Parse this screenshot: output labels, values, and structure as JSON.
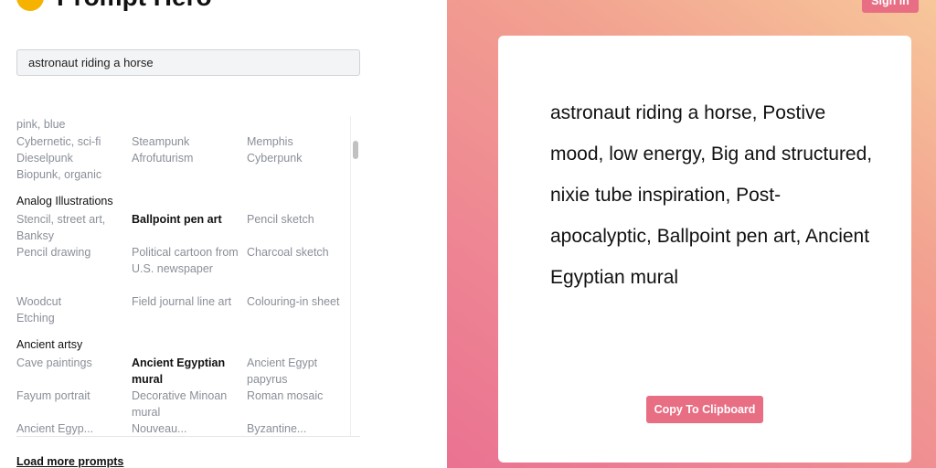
{
  "app": {
    "brand": "Prompt Hero",
    "signin_label": "Sign in"
  },
  "search": {
    "value": "astronaut riding a horse"
  },
  "list": {
    "rows": [
      {
        "c1": "pink, blue",
        "c2": "",
        "c3": ""
      },
      {
        "c1": "Cybernetic, sci-fi",
        "c2": "Steampunk",
        "c3": "Memphis"
      },
      {
        "c1": "Dieselpunk",
        "c2": "Afrofuturism",
        "c3": "Cyberpunk"
      },
      {
        "c1": "Biopunk, organic",
        "c2": "",
        "c3": ""
      }
    ],
    "analog_heading": "Analog Illustrations",
    "analog_rows": [
      {
        "c1": "Stencil, street art, Banksy",
        "c2": "Ballpoint pen art",
        "c3": "Pencil sketch"
      },
      {
        "c1": "Pencil drawing",
        "c2": "Political cartoon from U.S. newspaper",
        "c3": "Charcoal sketch"
      },
      {
        "c1": "Woodcut",
        "c2": "Field journal line art",
        "c3": "Colouring-in sheet"
      },
      {
        "c1": "Etching",
        "c2": "",
        "c3": ""
      }
    ],
    "ancient_heading": "Ancient artsy",
    "ancient_rows": [
      {
        "c1": "Cave paintings",
        "c2": "Ancient Egyptian mural",
        "c3": "Ancient Egypt papyrus"
      },
      {
        "c1": "Fayum portrait",
        "c2": "Decorative Minoan mural",
        "c3": "Roman mosaic"
      },
      {
        "c1": "Ancient Egyp...",
        "c2": "Nouveau...",
        "c3": "Byzantine..."
      }
    ],
    "load_more": "Load more prompts"
  },
  "output": {
    "prompt_text": "astronaut riding a horse, Postive mood, low energy, Big and structured, nixie tube inspiration, Post-apocalyptic, Ballpoint pen art, Ancient Egyptian mural",
    "copy_label": "Copy To Clipboard"
  },
  "colors": {
    "accent": "#e86e84"
  }
}
